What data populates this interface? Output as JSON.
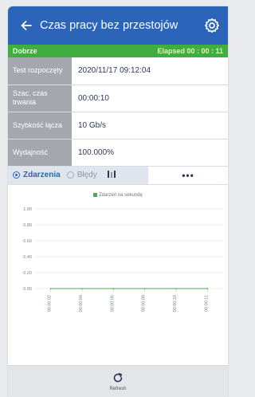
{
  "header": {
    "title": "Czas pracy bez przestojów",
    "back_icon": "back-arrow-icon",
    "settings_icon": "gear-icon",
    "bar_color": "#2c64b9"
  },
  "status": {
    "state": "Dobrze",
    "elapsed": "Elapsed 00 : 00 : 11",
    "bar_color": "#3fae3f"
  },
  "info": {
    "rows": [
      {
        "label": "Test rozpoczęty",
        "value": "2020/11/17 09:12:04"
      },
      {
        "label": "Szac. czas trwania",
        "value": "00:00:10"
      },
      {
        "label": "Szybkość łącza",
        "value": "10 Gb/s"
      },
      {
        "label": "Wydajność",
        "value": "100.000%"
      }
    ]
  },
  "tabs": {
    "events": "Zdarzenia",
    "errors": "Błędy",
    "bars_icon": "bar-chart-icon",
    "more": "•••",
    "selected": "Zdarzenia"
  },
  "chart_data": {
    "type": "line",
    "legend": "Zdarzeń na sekundę",
    "series": [
      {
        "name": "Zdarzeń na sekundę",
        "x": [
          "00:00:02",
          "00:00:04",
          "00:00:06",
          "00:00:08",
          "00:00:10",
          "00:00:11"
        ],
        "values": [
          0,
          0,
          0,
          0,
          0,
          0
        ],
        "color": "#48b048"
      }
    ],
    "y_ticks": [
      "1.00",
      "0.80",
      "0.60",
      "0.40",
      "0.20",
      "0.00"
    ],
    "x_ticks": [
      "00:00:02",
      "00:00:04",
      "00:00:06",
      "00:00:08",
      "00:00:10",
      "00:00:11"
    ],
    "ylim": [
      0,
      1
    ],
    "grid": true,
    "legend_position": "top-center"
  },
  "footer": {
    "refresh_icon": "refresh-icon",
    "refresh_label": "Refresh"
  }
}
